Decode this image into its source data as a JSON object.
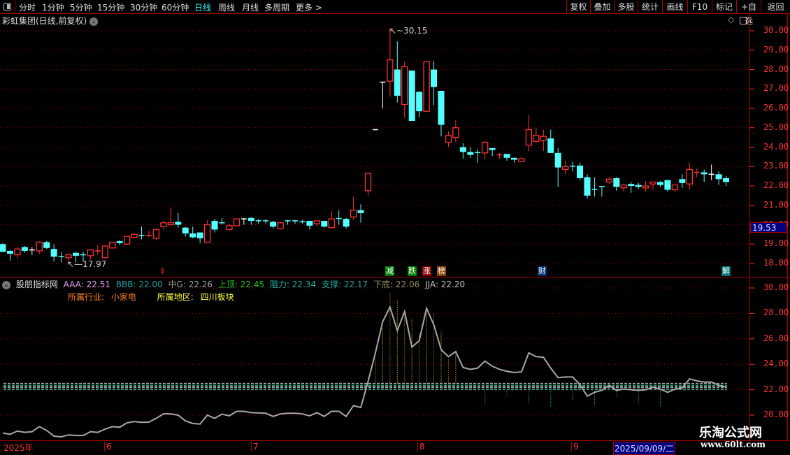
{
  "toolbar": {
    "periods": [
      "分时",
      "1分钟",
      "5分钟",
      "15分钟",
      "30分钟",
      "60分钟",
      "日线",
      "周线",
      "月线",
      "多周期",
      "更多 >"
    ],
    "active_period": "日线",
    "right_buttons": [
      "复权",
      "叠加",
      "多股",
      "统计",
      "画线",
      "F10",
      "标记",
      "+自选",
      "返回"
    ]
  },
  "chart": {
    "title": "彩虹集团(日线,前复权)",
    "price_ticks": [
      "30.00",
      "29.00",
      "28.00",
      "27.00",
      "26.00",
      "25.00",
      "24.00",
      "23.00",
      "22.00",
      "21.00",
      "20.00",
      "19.00",
      "18.00"
    ],
    "current_price_label": "19.53",
    "high_label": "30.15",
    "low_label": "17.97",
    "colors": {
      "up": "#ff3232",
      "down": "#54ffff",
      "flat": "#ffffff",
      "grid": "#a00000"
    },
    "candles": [
      [
        19.0,
        19.05,
        18.6,
        18.6
      ],
      [
        18.65,
        18.7,
        18.15,
        18.5
      ],
      [
        18.45,
        18.85,
        18.25,
        18.75
      ],
      [
        18.85,
        18.9,
        18.55,
        18.65
      ],
      [
        18.7,
        18.85,
        18.45,
        18.7
      ],
      [
        18.65,
        19.15,
        18.5,
        19.1
      ],
      [
        19.1,
        19.15,
        18.75,
        18.8
      ],
      [
        18.75,
        19.0,
        18.1,
        18.35
      ],
      [
        18.35,
        18.6,
        18.05,
        18.3
      ],
      [
        18.3,
        18.45,
        17.97,
        18.45
      ],
      [
        18.55,
        18.6,
        18.05,
        18.4
      ],
      [
        18.45,
        18.6,
        18.1,
        18.4
      ],
      [
        18.4,
        18.7,
        18.2,
        18.7
      ],
      [
        18.6,
        18.95,
        18.45,
        18.65
      ],
      [
        18.3,
        18.95,
        18.3,
        18.9
      ],
      [
        18.8,
        19.1,
        18.8,
        19.1
      ],
      [
        19.15,
        19.2,
        18.95,
        19.05
      ],
      [
        19.0,
        19.4,
        18.95,
        19.4
      ],
      [
        19.35,
        19.55,
        19.3,
        19.5
      ],
      [
        19.45,
        19.9,
        19.25,
        19.44
      ],
      [
        19.4,
        19.7,
        19.35,
        19.45
      ],
      [
        19.3,
        19.8,
        19.2,
        19.75
      ],
      [
        19.9,
        20.2,
        19.75,
        20.1
      ],
      [
        20.0,
        20.9,
        19.95,
        20.1
      ],
      [
        20.15,
        20.6,
        19.85,
        20.0
      ],
      [
        19.85,
        19.9,
        19.4,
        19.55
      ],
      [
        19.55,
        19.9,
        19.3,
        19.35
      ],
      [
        19.6,
        19.6,
        19.05,
        19.3
      ],
      [
        19.1,
        20.23,
        19.1,
        20.0
      ],
      [
        20.2,
        20.3,
        19.6,
        19.75
      ],
      [
        20.1,
        20.35,
        20.0,
        20.08
      ],
      [
        19.75,
        20.05,
        19.7,
        19.95
      ],
      [
        19.95,
        20.3,
        19.95,
        20.3
      ],
      [
        20.3,
        20.35,
        20.0,
        20.3
      ],
      [
        20.35,
        20.4,
        20.0,
        20.2
      ],
      [
        20.2,
        20.3,
        20.05,
        20.18
      ],
      [
        20.2,
        20.3,
        20.05,
        20.15
      ],
      [
        20.15,
        20.2,
        19.8,
        19.9
      ],
      [
        19.8,
        20.15,
        19.75,
        20.1
      ],
      [
        20.2,
        20.25,
        20.0,
        20.15
      ],
      [
        20.2,
        20.25,
        20.05,
        20.15
      ],
      [
        20.15,
        20.25,
        20.05,
        20.1
      ],
      [
        20.2,
        20.2,
        19.75,
        19.95
      ],
      [
        20.05,
        20.2,
        19.9,
        20.2
      ],
      [
        20.2,
        20.2,
        19.85,
        19.9
      ],
      [
        19.85,
        20.7,
        19.85,
        20.3
      ],
      [
        20.32,
        20.75,
        20.0,
        20.3
      ],
      [
        20.3,
        20.35,
        19.8,
        19.9
      ],
      [
        20.4,
        21.45,
        20.25,
        20.75
      ],
      [
        20.75,
        21.05,
        20.1,
        20.6
      ],
      [
        21.75,
        22.65,
        21.5,
        22.65
      ],
      [
        24.9,
        24.9,
        24.9,
        24.9
      ],
      [
        27.35,
        27.35,
        26.0,
        27.35
      ],
      [
        27.4,
        30.15,
        26.6,
        28.5
      ],
      [
        28.0,
        29.45,
        26.3,
        26.65
      ],
      [
        26.2,
        28.4,
        25.5,
        28.15
      ],
      [
        27.95,
        27.95,
        25.35,
        25.35
      ],
      [
        26.85,
        26.9,
        25.55,
        25.85
      ],
      [
        25.85,
        28.4,
        25.85,
        28.4
      ],
      [
        28.0,
        28.45,
        26.15,
        27.1
      ],
      [
        26.9,
        26.9,
        24.55,
        25.15
      ],
      [
        24.25,
        24.8,
        24.0,
        24.6
      ],
      [
        24.5,
        25.4,
        24.25,
        25.0
      ],
      [
        24.0,
        24.2,
        23.4,
        23.75
      ],
      [
        23.75,
        24.0,
        23.45,
        23.6
      ],
      [
        23.72,
        23.9,
        23.2,
        23.7
      ],
      [
        23.7,
        24.3,
        23.35,
        24.25
      ],
      [
        23.95,
        23.95,
        23.55,
        23.85
      ],
      [
        23.58,
        23.7,
        23.4,
        23.6
      ],
      [
        23.65,
        23.65,
        23.3,
        23.45
      ],
      [
        23.45,
        23.45,
        23.2,
        23.35
      ],
      [
        23.25,
        23.5,
        23.25,
        23.4
      ],
      [
        24.1,
        25.65,
        23.8,
        24.9
      ],
      [
        24.3,
        25.0,
        24.2,
        24.6
      ],
      [
        24.35,
        24.9,
        23.8,
        24.55
      ],
      [
        24.45,
        24.9,
        23.7,
        23.7
      ],
      [
        23.7,
        23.95,
        21.95,
        22.95
      ],
      [
        22.85,
        23.3,
        22.6,
        23.0
      ],
      [
        23.02,
        23.25,
        22.75,
        23.0
      ],
      [
        23.05,
        23.2,
        22.3,
        22.4
      ],
      [
        22.45,
        22.6,
        21.35,
        21.5
      ],
      [
        21.82,
        22.45,
        21.45,
        21.8
      ],
      [
        21.97,
        21.97,
        21.45,
        21.95
      ],
      [
        22.2,
        22.45,
        22.1,
        22.35
      ],
      [
        22.4,
        22.45,
        21.75,
        21.95
      ],
      [
        21.9,
        22.1,
        21.7,
        22.05
      ],
      [
        22.1,
        22.2,
        21.65,
        22.0
      ],
      [
        22.05,
        22.15,
        21.85,
        21.95
      ],
      [
        21.9,
        22.25,
        21.7,
        22.0
      ],
      [
        22.1,
        22.2,
        21.8,
        22.2
      ],
      [
        22.2,
        22.25,
        21.95,
        22.05
      ],
      [
        22.3,
        22.3,
        21.7,
        21.8
      ],
      [
        21.8,
        22.05,
        21.7,
        22.05
      ],
      [
        22.35,
        22.6,
        21.9,
        22.15
      ],
      [
        22.1,
        23.2,
        21.8,
        22.85
      ],
      [
        22.65,
        22.9,
        22.45,
        22.7
      ],
      [
        22.7,
        22.85,
        22.2,
        22.6
      ],
      [
        22.6,
        23.1,
        22.3,
        22.6
      ],
      [
        22.6,
        22.75,
        22.05,
        22.35
      ],
      [
        22.4,
        22.5,
        22.0,
        22.2
      ]
    ],
    "markers": [
      {
        "text": "$",
        "color": "#ff2020",
        "bg": "transparent"
      },
      {
        "text": "减",
        "color": "#fff",
        "bg": "#008000"
      },
      {
        "text": "跌",
        "color": "#fff",
        "bg": "#008000"
      },
      {
        "text": "涨",
        "color": "#fff",
        "bg": "#8b0000"
      },
      {
        "text": "榜",
        "color": "#fff",
        "bg": "#8b4500"
      },
      {
        "text": "财",
        "color": "#fff",
        "bg": "#003070"
      },
      {
        "text": "解",
        "color": "#fff",
        "bg": "#007070"
      }
    ]
  },
  "indicator": {
    "name": "股朋指标网",
    "values": [
      {
        "label": "AAA: 22.51",
        "color": "#e0a0f0",
        "value": 22.51
      },
      {
        "label": "BBB: 22.00",
        "color": "#20a0a0",
        "value": 22.0
      },
      {
        "label": "中G: 22.26",
        "color": "#a0a0a0",
        "value": 22.26
      },
      {
        "label": "上顶: 22.45",
        "color": "#20c020",
        "value": 22.45
      },
      {
        "label": "阻力: 22.34",
        "color": "#20b0a0",
        "value": 22.34
      },
      {
        "label": "支撑: 22.17",
        "color": "#20a0a0",
        "value": 22.17
      },
      {
        "label": "下底: 22.06",
        "color": "#909060",
        "value": 22.06
      },
      {
        "label": "JJA: 22.20",
        "color": "#c0c0c0",
        "value": 22.2
      }
    ],
    "industry_label": "所属行业:",
    "industry": "小家电",
    "region_label": "所属地区:",
    "region": "四川板块",
    "ticks": [
      "30.00",
      "28.00",
      "26.00",
      "24.00",
      "22.00",
      "20.00"
    ]
  },
  "dates": {
    "labels": [
      "2025年",
      "6",
      "7",
      "8",
      "9"
    ],
    "current": "2025/09/09/二"
  },
  "watermark": {
    "name": "乐淘公式网",
    "url": "www.60lt.com"
  }
}
